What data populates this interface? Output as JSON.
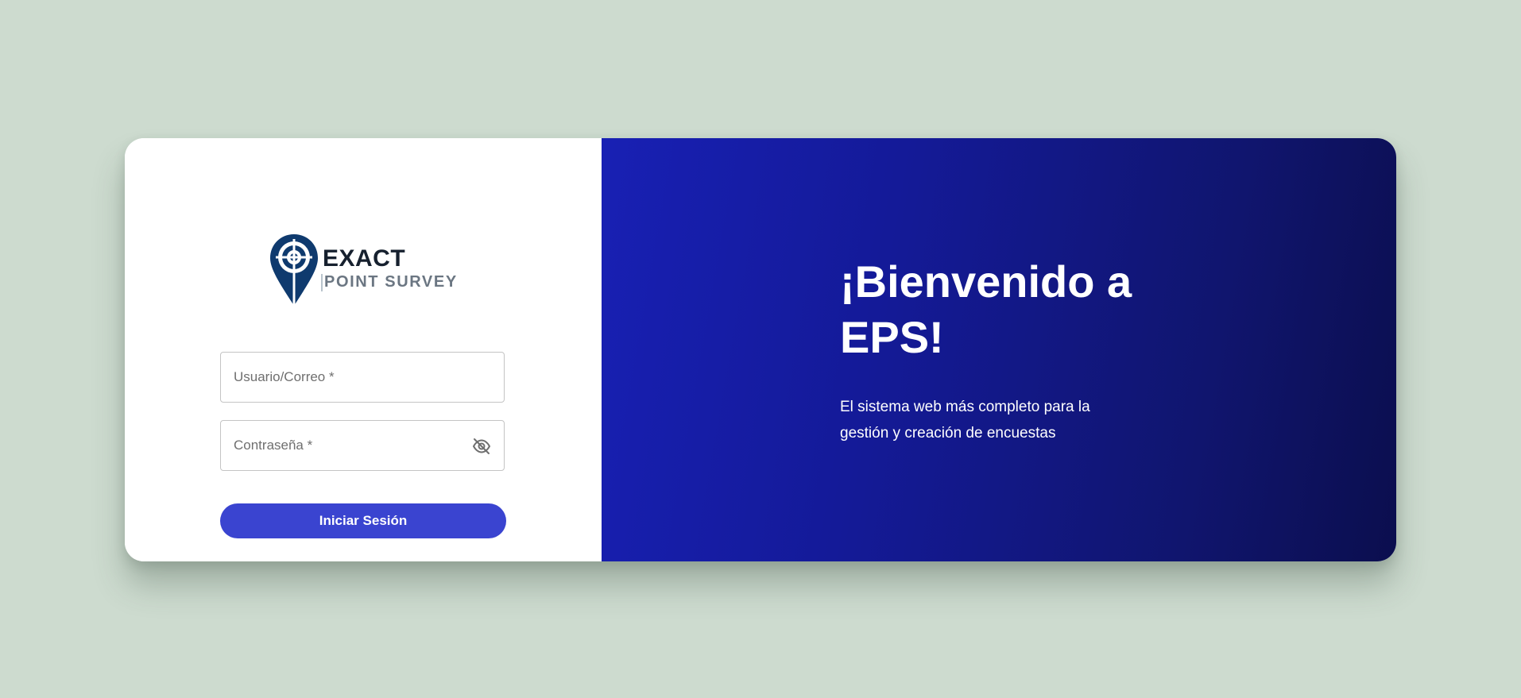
{
  "logo": {
    "line1": "EXACT",
    "line2": "POINT SURVEY",
    "icon": "map-pin-crosshair-icon",
    "color": "#0f3a6e"
  },
  "login": {
    "username_placeholder": "Usuario/Correo *",
    "username_value": "",
    "password_placeholder": "Contraseña *",
    "password_value": "",
    "toggle_icon": "eye-off-icon",
    "submit_label": "Iniciar Sesión"
  },
  "welcome": {
    "title": "¡Bienvenido a EPS!",
    "subtitle": "El sistema web más completo para la gestión y creación de encuestas"
  },
  "colors": {
    "background": "#cddbcf",
    "button": "#3a44d0",
    "panel_gradient_start": "#1820b4",
    "panel_gradient_end": "#0b0e4e"
  }
}
